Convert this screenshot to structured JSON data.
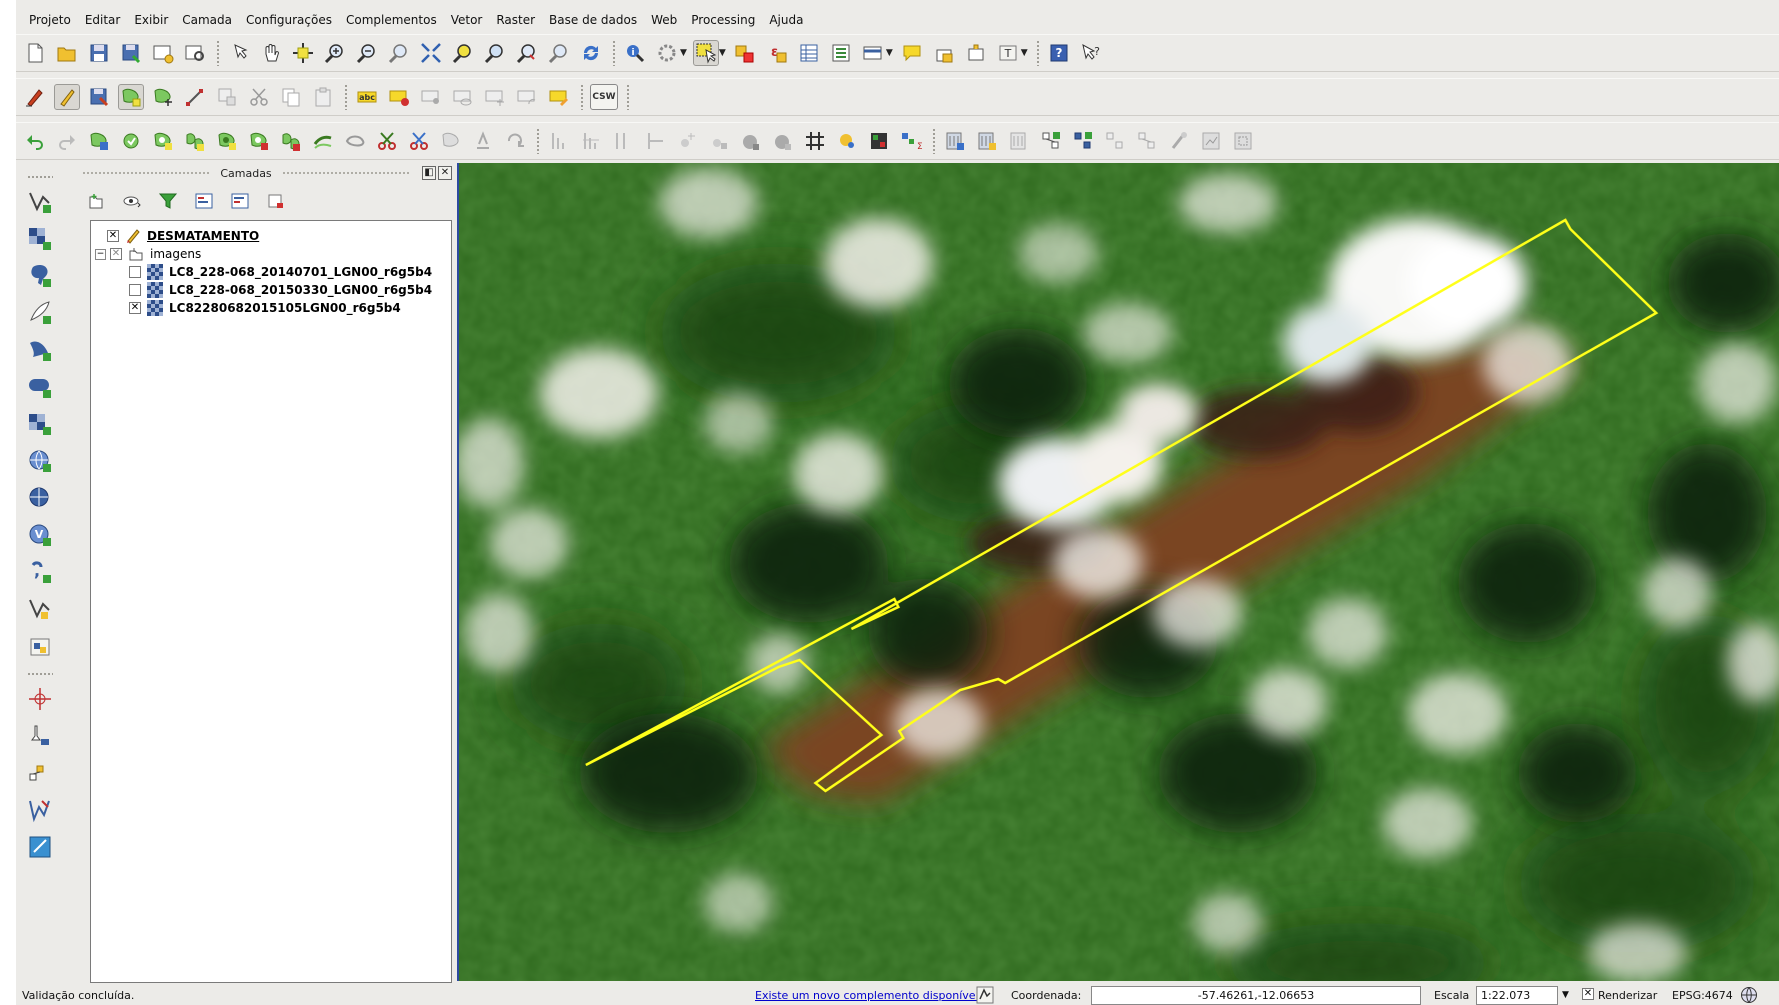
{
  "menu": [
    "Projeto",
    "Editar",
    "Exibir",
    "Camada",
    "Configurações",
    "Complementos",
    "Vetor",
    "Raster",
    "Base de dados",
    "Web",
    "Processing",
    "Ajuda"
  ],
  "toolbar": {
    "label_abc": "abc",
    "label_csw": "CSW",
    "label_t": "T",
    "label_help": "?",
    "label_whatsthis": "?"
  },
  "layers_panel": {
    "title": "Camadas",
    "tree": [
      {
        "name": "DESMATAMENTO",
        "checked": true,
        "kind": "vector",
        "bold": true,
        "underline": true
      },
      {
        "name": "imagens",
        "kind": "group"
      },
      {
        "name": "LC8_228-068_20140701_LGN00_r6g5b4",
        "checked": false,
        "kind": "raster"
      },
      {
        "name": "LC8_228-068_20150330_LGN00_r6g5b4",
        "checked": false,
        "kind": "raster"
      },
      {
        "name": "LC82280682015105LGN00_r6g5b4",
        "checked": true,
        "kind": "raster"
      }
    ]
  },
  "status": {
    "message": "Validação concluída.",
    "plugin_link": "Existe um novo complemento disponível",
    "coord_label": "Coordenada:",
    "coord_value": "-57.46261,-12.06653",
    "scale_label": "Escala",
    "scale_value": "1:22.073",
    "render_label": "Renderizar",
    "crs": "EPSG:4674"
  },
  "colors": {
    "polygon_outline": "#ffff1a",
    "forest": "#2f6a1e",
    "clearing": "#7a4424",
    "cloud": "#f4f1ec",
    "accent_blue": "#2c4aa0"
  }
}
